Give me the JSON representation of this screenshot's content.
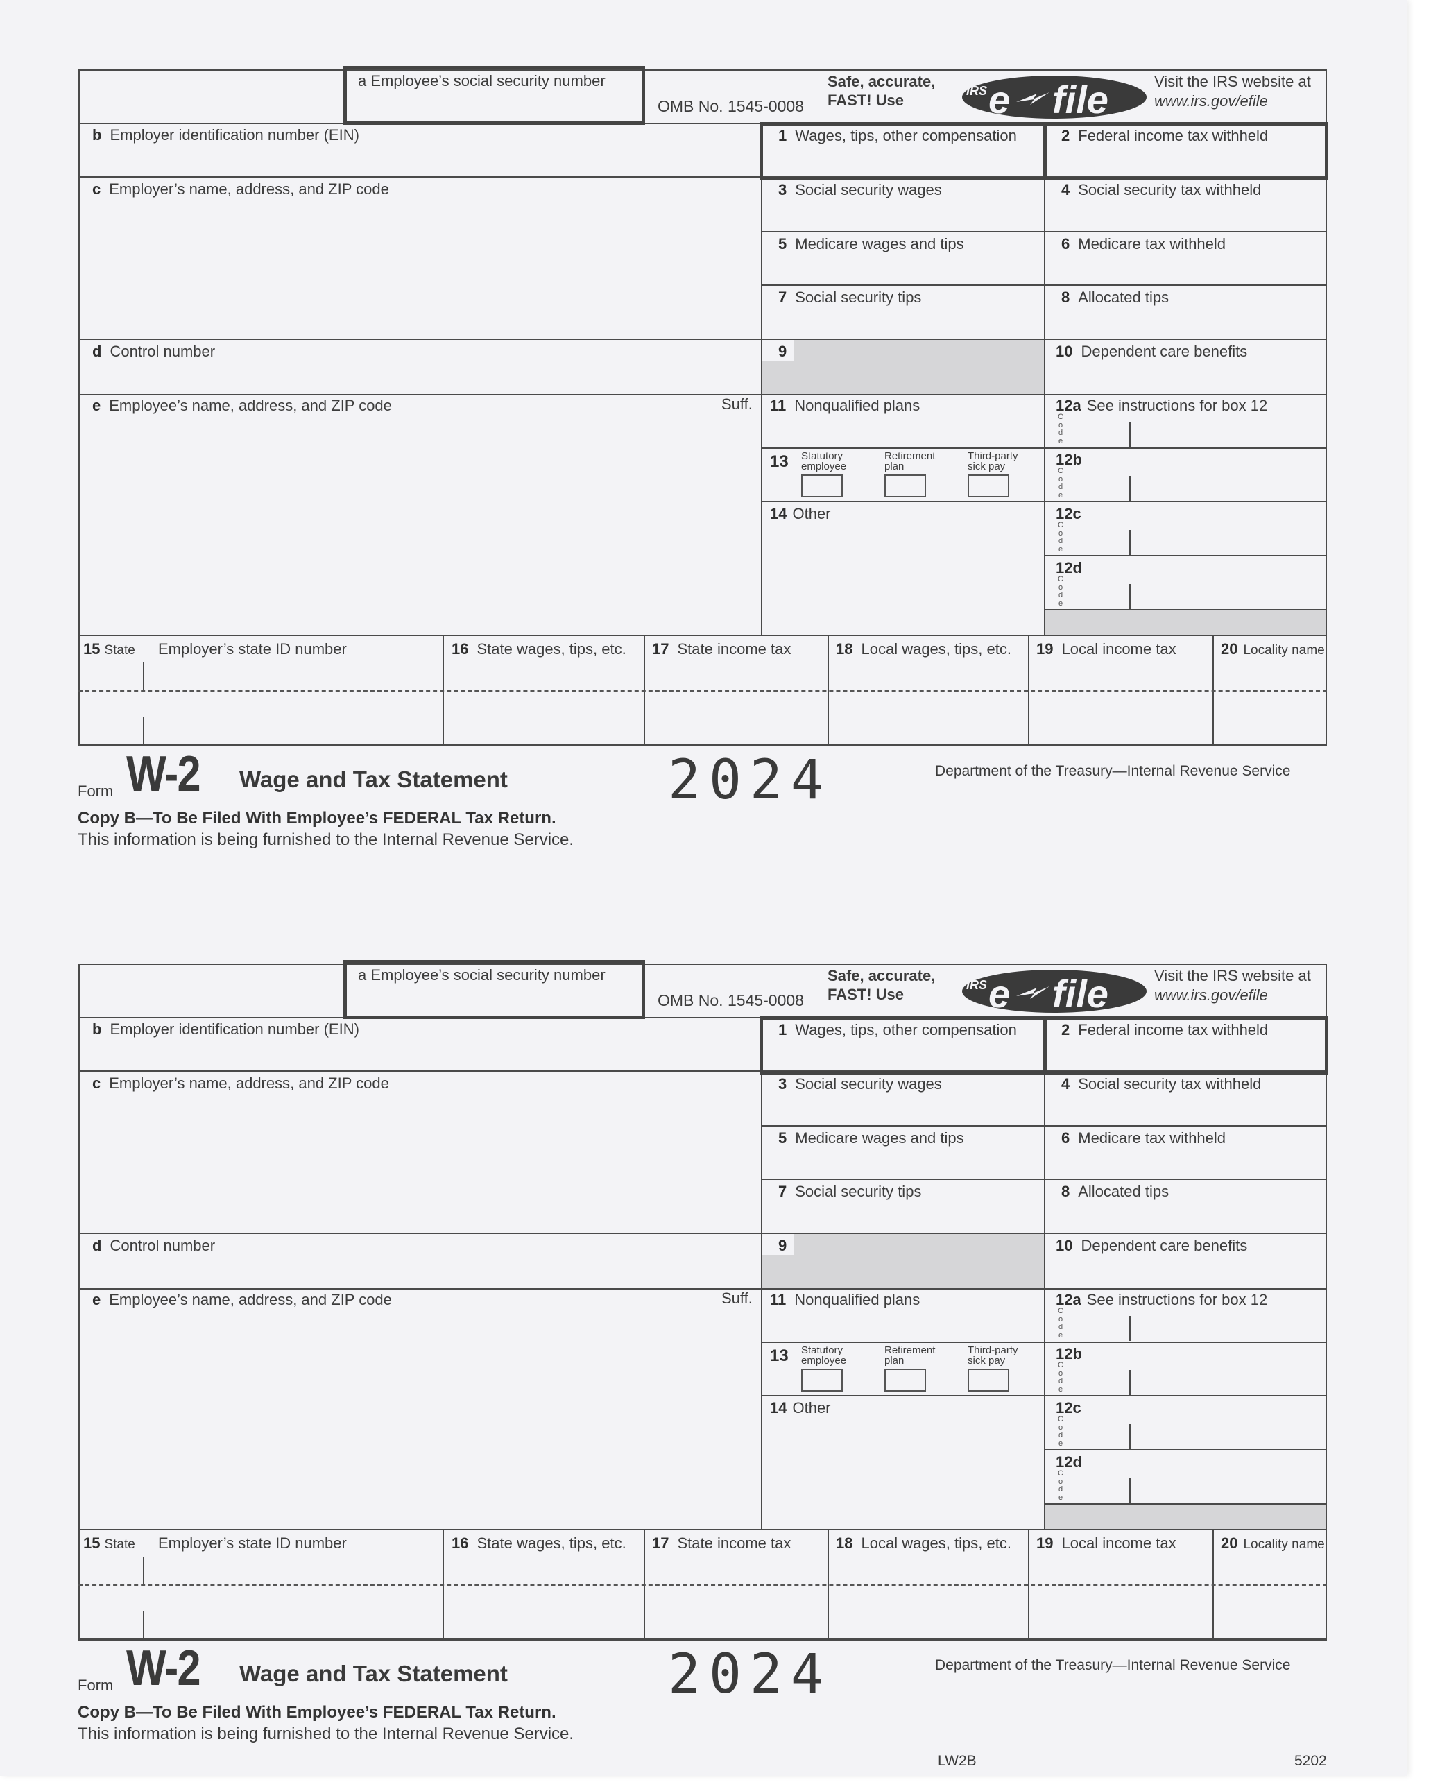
{
  "document": {
    "forms": [
      {
        "copy": "top",
        "box_a": "a  Employee’s social security number",
        "omb": "OMB No. 1545-0008",
        "efile_tagline_1": "Safe, accurate,",
        "efile_tagline_2": "FAST! Use",
        "efile_logo_irs": "IRS",
        "efile_logo_text": "e-file",
        "visit_1": "Visit the IRS website at",
        "visit_2": "www.irs.gov/efile",
        "box_b": {
          "letter": "b",
          "label": "Employer identification number (EIN)"
        },
        "box_c": {
          "letter": "c",
          "label": "Employer’s name, address, and ZIP code"
        },
        "box_d": {
          "letter": "d",
          "label": "Control number"
        },
        "box_e": {
          "letter": "e",
          "label": "Employee’s name, address, and ZIP code"
        },
        "suff": "Suff.",
        "boxes": {
          "b1": {
            "num": "1",
            "label": "Wages, tips, other compensation"
          },
          "b2": {
            "num": "2",
            "label": "Federal income tax withheld"
          },
          "b3": {
            "num": "3",
            "label": "Social security wages"
          },
          "b4": {
            "num": "4",
            "label": "Social security tax withheld"
          },
          "b5": {
            "num": "5",
            "label": "Medicare wages and tips"
          },
          "b6": {
            "num": "6",
            "label": "Medicare tax withheld"
          },
          "b7": {
            "num": "7",
            "label": "Social security tips"
          },
          "b8": {
            "num": "8",
            "label": "Allocated tips"
          },
          "b9": {
            "num": "9",
            "label": ""
          },
          "b10": {
            "num": "10",
            "label": "Dependent care benefits"
          },
          "b11": {
            "num": "11",
            "label": "Nonqualified plans"
          },
          "b12a": {
            "num": "12a",
            "label": "See instructions for box 12"
          },
          "b12b": {
            "num": "12b",
            "label": ""
          },
          "b12c": {
            "num": "12c",
            "label": ""
          },
          "b12d": {
            "num": "12d",
            "label": ""
          },
          "b13": {
            "num": "13",
            "statutory_1": "Statutory",
            "statutory_2": "employee",
            "retirement_1": "Retirement",
            "retirement_2": "plan",
            "thirdparty_1": "Third-party",
            "thirdparty_2": "sick pay"
          },
          "b14": {
            "num": "14",
            "label": "Other"
          },
          "b15": {
            "num": "15",
            "state": "State",
            "label": "Employer’s state ID number"
          },
          "b16": {
            "num": "16",
            "label": "State wages, tips, etc."
          },
          "b17": {
            "num": "17",
            "label": "State income tax"
          },
          "b18": {
            "num": "18",
            "label": "Local wages, tips, etc."
          },
          "b19": {
            "num": "19",
            "label": "Local income tax"
          },
          "b20": {
            "num": "20",
            "label": "Locality name"
          }
        },
        "code_letters": [
          "C",
          "o",
          "d",
          "e"
        ],
        "footer": {
          "form_word": "Form",
          "form_name": "W-2",
          "title": "Wage and Tax Statement",
          "year": "2024",
          "dept": "Department of the Treasury—Internal Revenue Service",
          "copy_b": "Copy B—To Be Filed With Employee’s FEDERAL Tax Return.",
          "furnish": "This information is being furnished to the Internal Revenue Service.",
          "form_code": "",
          "form_number": ""
        }
      },
      {
        "copy": "bottom",
        "box_a": "a  Employee’s social security number",
        "omb": "OMB No. 1545-0008",
        "efile_tagline_1": "Safe, accurate,",
        "efile_tagline_2": "FAST! Use",
        "efile_logo_irs": "IRS",
        "efile_logo_text": "e-file",
        "visit_1": "Visit the IRS website at",
        "visit_2": "www.irs.gov/efile",
        "box_b": {
          "letter": "b",
          "label": "Employer identification number (EIN)"
        },
        "box_c": {
          "letter": "c",
          "label": "Employer’s name, address, and ZIP code"
        },
        "box_d": {
          "letter": "d",
          "label": "Control number"
        },
        "box_e": {
          "letter": "e",
          "label": "Employee’s name, address, and ZIP code"
        },
        "suff": "Suff.",
        "boxes": {
          "b1": {
            "num": "1",
            "label": "Wages, tips, other compensation"
          },
          "b2": {
            "num": "2",
            "label": "Federal income tax withheld"
          },
          "b3": {
            "num": "3",
            "label": "Social security wages"
          },
          "b4": {
            "num": "4",
            "label": "Social security tax withheld"
          },
          "b5": {
            "num": "5",
            "label": "Medicare wages and tips"
          },
          "b6": {
            "num": "6",
            "label": "Medicare tax withheld"
          },
          "b7": {
            "num": "7",
            "label": "Social security tips"
          },
          "b8": {
            "num": "8",
            "label": "Allocated tips"
          },
          "b9": {
            "num": "9",
            "label": ""
          },
          "b10": {
            "num": "10",
            "label": "Dependent care benefits"
          },
          "b11": {
            "num": "11",
            "label": "Nonqualified plans"
          },
          "b12a": {
            "num": "12a",
            "label": "See instructions for box 12"
          },
          "b12b": {
            "num": "12b",
            "label": ""
          },
          "b12c": {
            "num": "12c",
            "label": ""
          },
          "b12d": {
            "num": "12d",
            "label": ""
          },
          "b13": {
            "num": "13",
            "statutory_1": "Statutory",
            "statutory_2": "employee",
            "retirement_1": "Retirement",
            "retirement_2": "plan",
            "thirdparty_1": "Third-party",
            "thirdparty_2": "sick pay"
          },
          "b14": {
            "num": "14",
            "label": "Other"
          },
          "b15": {
            "num": "15",
            "state": "State",
            "label": "Employer’s state ID number"
          },
          "b16": {
            "num": "16",
            "label": "State wages, tips, etc."
          },
          "b17": {
            "num": "17",
            "label": "State income tax"
          },
          "b18": {
            "num": "18",
            "label": "Local wages, tips, etc."
          },
          "b19": {
            "num": "19",
            "label": "Local income tax"
          },
          "b20": {
            "num": "20",
            "label": "Locality name"
          }
        },
        "code_letters": [
          "C",
          "o",
          "d",
          "e"
        ],
        "footer": {
          "form_word": "Form",
          "form_name": "W-2",
          "title": "Wage and Tax Statement",
          "year": "2024",
          "dept": "Department of the Treasury—Internal Revenue Service",
          "copy_b": "Copy B—To Be Filed With Employee’s FEDERAL Tax Return.",
          "furnish": "This information is being furnished to the Internal Revenue Service.",
          "form_code": "LW2B",
          "form_number": "5202"
        }
      }
    ]
  }
}
